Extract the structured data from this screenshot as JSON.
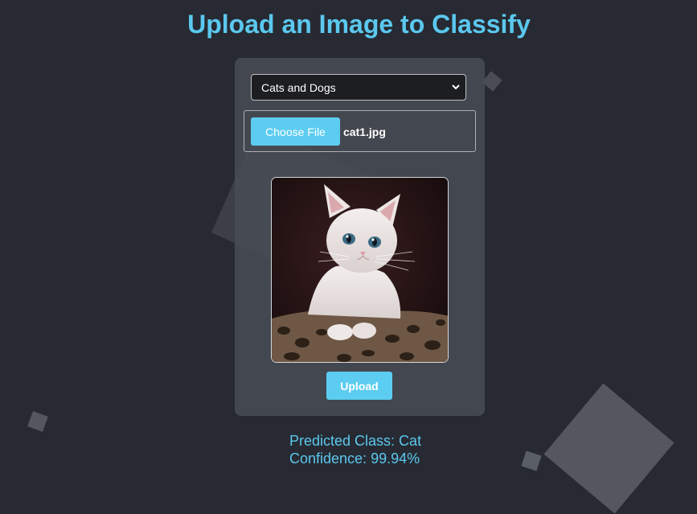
{
  "page": {
    "title": "Upload an Image to Classify"
  },
  "form": {
    "model_select": {
      "selected": "Cats and Dogs",
      "icon": "chevron-down-icon"
    },
    "file_input": {
      "button_label": "Choose File",
      "file_name": "cat1.jpg"
    },
    "preview": {
      "subject": "white kitten"
    },
    "upload_label": "Upload"
  },
  "result": {
    "predicted_class": "Predicted Class: Cat",
    "confidence": "Confidence: 99.94%"
  },
  "colors": {
    "background": "#272a32",
    "card": "#484c54",
    "accent": "#5ccdf0",
    "title": "#5bc8ef"
  }
}
